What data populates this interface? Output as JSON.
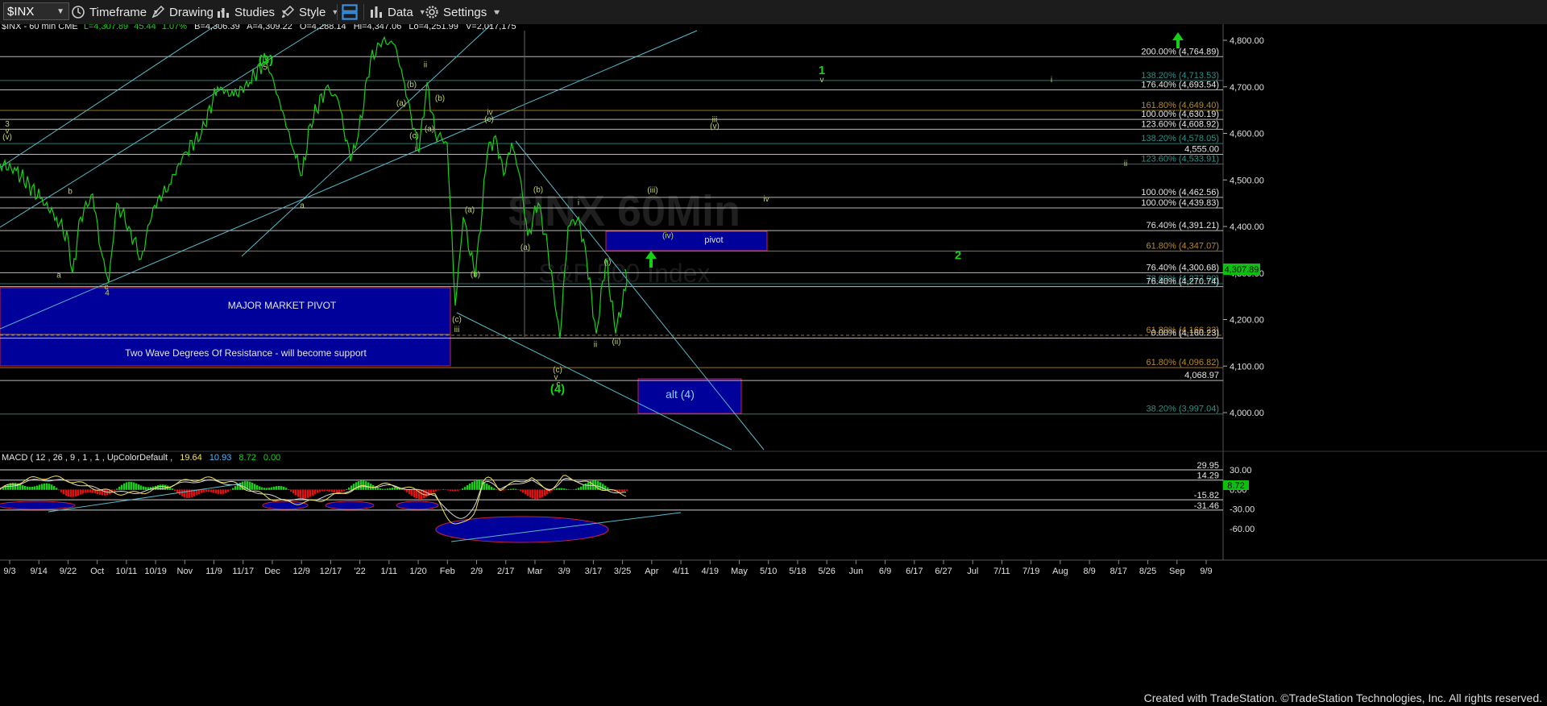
{
  "toolbar": {
    "symbol": "$INX",
    "timeframe": "Timeframe",
    "drawing": "Drawing",
    "studies": "Studies",
    "style": "Style",
    "data": "Data",
    "settings": "Settings"
  },
  "chart_data": {
    "type": "line",
    "header": {
      "symbol_line": "$INX - 60 min CME",
      "last": "L=4,307.89",
      "change": "45.44",
      "pct": "1.07%",
      "bid": "B=4,306.39",
      "ask": "A=4,309.22",
      "open": "O=4,288.14",
      "high": "Hi=4,347.06",
      "low": "Lo=4,251.99",
      "volume": "V=2,017,175"
    },
    "ylim": [
      3940,
      4830
    ],
    "y_ticks": [
      "4,800.00",
      "4,700.00",
      "4,600.00",
      "4,500.00",
      "4,400.00",
      "4,300.00",
      "4,200.00",
      "4,100.00",
      "4,000.00"
    ],
    "last_price_tag": "4,307.89",
    "x_labels": [
      "9/3",
      "9/14",
      "9/22",
      "Oct",
      "10/11",
      "10/19",
      "Nov",
      "11/9",
      "11/17",
      "Dec",
      "12/9",
      "12/17",
      "'22",
      "1/11",
      "1/20",
      "Feb",
      "2/9",
      "2/17",
      "Mar",
      "3/9",
      "3/17",
      "3/25",
      "Apr",
      "4/11",
      "4/19",
      "May",
      "5/10",
      "5/18",
      "5/26",
      "Jun",
      "6/9",
      "6/17",
      "6/27",
      "Jul",
      "7/11",
      "7/19",
      "Aug",
      "8/9",
      "8/17",
      "8/25",
      "Sep",
      "9/9"
    ],
    "price_series": {
      "name": "$INX",
      "points": [
        [
          0,
          4535
        ],
        [
          20,
          4520
        ],
        [
          50,
          4460
        ],
        [
          70,
          4420
        ],
        [
          85,
          4370
        ],
        [
          90,
          4300
        ],
        [
          100,
          4420
        ],
        [
          115,
          4470
        ],
        [
          125,
          4350
        ],
        [
          135,
          4280
        ],
        [
          145,
          4450
        ],
        [
          160,
          4400
        ],
        [
          175,
          4330
        ],
        [
          190,
          4440
        ],
        [
          210,
          4490
        ],
        [
          230,
          4560
        ],
        [
          250,
          4600
        ],
        [
          270,
          4700
        ],
        [
          290,
          4680
        ],
        [
          310,
          4710
        ],
        [
          330,
          4760
        ],
        [
          345,
          4680
        ],
        [
          365,
          4560
        ],
        [
          375,
          4510
        ],
        [
          385,
          4620
        ],
        [
          405,
          4700
        ],
        [
          420,
          4670
        ],
        [
          435,
          4540
        ],
        [
          445,
          4600
        ],
        [
          460,
          4760
        ],
        [
          475,
          4800
        ],
        [
          490,
          4790
        ],
        [
          500,
          4720
        ],
        [
          510,
          4640
        ],
        [
          520,
          4560
        ],
        [
          530,
          4710
        ],
        [
          540,
          4600
        ],
        [
          555,
          4580
        ],
        [
          565,
          4230
        ],
        [
          575,
          4420
        ],
        [
          590,
          4290
        ],
        [
          605,
          4560
        ],
        [
          615,
          4595
        ],
        [
          625,
          4510
        ],
        [
          635,
          4580
        ],
        [
          645,
          4510
        ],
        [
          655,
          4380
        ],
        [
          668,
          4450
        ],
        [
          680,
          4350
        ],
        [
          695,
          4160
        ],
        [
          705,
          4400
        ],
        [
          718,
          4420
        ],
        [
          728,
          4330
        ],
        [
          740,
          4170
        ],
        [
          752,
          4330
        ],
        [
          764,
          4170
        ],
        [
          778,
          4280
        ],
        [
          775,
          4307
        ]
      ]
    },
    "wave_labels": [
      {
        "text": "(3)",
        "x": 330,
        "y": 4750,
        "size": "large"
      },
      {
        "text": "5",
        "x": 329,
        "y": 4737
      },
      {
        "text": "3",
        "x": 9,
        "y": 4615
      },
      {
        "text": "v",
        "x": 9,
        "y": 4600
      },
      {
        "text": "(v)",
        "x": 9,
        "y": 4587
      },
      {
        "text": "b",
        "x": 87,
        "y": 4470
      },
      {
        "text": "a",
        "x": 73,
        "y": 4290
      },
      {
        "text": "c",
        "x": 132,
        "y": 4265
      },
      {
        "text": "4",
        "x": 133,
        "y": 4252
      },
      {
        "text": "a",
        "x": 375,
        "y": 4440
      },
      {
        "text": "ii",
        "x": 528,
        "y": 4742
      },
      {
        "text": "(b)",
        "x": 511,
        "y": 4700
      },
      {
        "text": "(a)",
        "x": 498,
        "y": 4660
      },
      {
        "text": "(b)",
        "x": 546,
        "y": 4670
      },
      {
        "text": "(c)",
        "x": 514,
        "y": 4590
      },
      {
        "text": "(a)",
        "x": 533,
        "y": 4604
      },
      {
        "text": "i",
        "x": 516,
        "y": 4563
      },
      {
        "text": "iv",
        "x": 608,
        "y": 4640
      },
      {
        "text": "(c)",
        "x": 607,
        "y": 4625
      },
      {
        "text": "(a)",
        "x": 583,
        "y": 4430
      },
      {
        "text": "(b)",
        "x": 590,
        "y": 4292
      },
      {
        "text": "(c)",
        "x": 567,
        "y": 4195
      },
      {
        "text": "iii",
        "x": 567,
        "y": 4173
      },
      {
        "text": "(b)",
        "x": 668,
        "y": 4474
      },
      {
        "text": "(a)",
        "x": 652,
        "y": 4350
      },
      {
        "text": "(c)",
        "x": 692,
        "y": 4087
      },
      {
        "text": "v",
        "x": 690,
        "y": 4071
      },
      {
        "text": "c",
        "x": 693,
        "y": 4056
      },
      {
        "text": "(4)",
        "x": 692,
        "y": 4042,
        "size": "large"
      },
      {
        "text": "i",
        "x": 718,
        "y": 4446
      },
      {
        "text": "(i)",
        "x": 754,
        "y": 4319
      },
      {
        "text": "ii",
        "x": 739,
        "y": 4141
      },
      {
        "text": "(ii)",
        "x": 765,
        "y": 4147
      },
      {
        "text": "(iii)",
        "x": 810,
        "y": 4473
      },
      {
        "text": "(iv)",
        "x": 829,
        "y": 4375
      },
      {
        "text": "iii",
        "x": 887,
        "y": 4624
      },
      {
        "text": "(v)",
        "x": 887,
        "y": 4610
      },
      {
        "text": "iv",
        "x": 951,
        "y": 4454
      },
      {
        "text": "1",
        "x": 1020,
        "y": 4727,
        "size": "large"
      },
      {
        "text": "v",
        "x": 1020,
        "y": 4710
      },
      {
        "text": "i",
        "x": 1305,
        "y": 4710
      },
      {
        "text": "ii",
        "x": 1397,
        "y": 4530
      },
      {
        "text": "2",
        "x": 1189,
        "y": 4330,
        "size": "large"
      }
    ],
    "fib_levels": [
      {
        "label": "200.00% (4,764.89)",
        "value": 4764.89,
        "color": "#d8d8d8",
        "dashed": false
      },
      {
        "label": "138.20% (4,713.53)",
        "value": 4713.53,
        "color": "#2f8f86",
        "dashed": false
      },
      {
        "label": "176.40% (4,693.54)",
        "value": 4693.54,
        "color": "#d8d8d8",
        "dashed": false
      },
      {
        "label": "161.80% (4,649.40)",
        "value": 4649.4,
        "color": "#b48a2a",
        "dashed": false
      },
      {
        "label": "100.00% (4,630.19)",
        "value": 4630.19,
        "color": "#d8d8d8",
        "dashed": false
      },
      {
        "label": "123.60% (4,608.92)",
        "value": 4608.92,
        "color": "#d8d8d8",
        "dashed": false
      },
      {
        "label": "138.20% (4,578.05)",
        "value": 4578.05,
        "color": "#2f8f86",
        "dashed": false
      },
      {
        "label": "4,555.00",
        "value": 4555.0,
        "color": "#d8d8d8",
        "dashed": false
      },
      {
        "label": "123.60% (4,533.91)",
        "value": 4533.91,
        "color": "#2f8f86",
        "dashed": false
      },
      {
        "label": "100.00% (4,462.56)",
        "value": 4462.56,
        "color": "#d8d8d8",
        "dashed": false
      },
      {
        "label": "100.00% (4,439.83)",
        "value": 4439.83,
        "color": "#d8d8d8",
        "dashed": false
      },
      {
        "label": "76.40% (4,391.21)",
        "value": 4391.21,
        "color": "#d8d8d8",
        "dashed": false
      },
      {
        "label": "61.80% (4,347.07)",
        "value": 4347.07,
        "color": "#b48a2a",
        "dashed": false
      },
      {
        "label": "76.40% (4,300.68)",
        "value": 4300.68,
        "color": "#d8d8d8",
        "dashed": false
      },
      {
        "label": "78.60% (4,277.00)",
        "value": 4277.0,
        "color": "#2f8f86",
        "dashed": false
      },
      {
        "label": "76.40% (4,270.74)",
        "value": 4270.74,
        "color": "#d8d8d8",
        "dashed": false
      },
      {
        "label": "61.80% (4,166.23)",
        "value": 4166.23,
        "color": "#b48a2a",
        "dashed": true
      },
      {
        "label": "0.00% (4,160.23)",
        "value": 4160.23,
        "color": "#d8d8d8",
        "dashed": false
      },
      {
        "label": "61.80% (4,096.82)",
        "value": 4096.82,
        "color": "#b48a2a",
        "dashed": false
      },
      {
        "label": "4,068.97",
        "value": 4068.97,
        "color": "#d8d8d8",
        "dashed": false
      },
      {
        "label": "38.20% (3,997.04)",
        "value": 3997.04,
        "color": "#2f8f86",
        "dashed": false
      }
    ],
    "boxes": [
      {
        "label": "MAJOR MARKET PIVOT",
        "sub": "Two Wave Degrees Of Resistance - will become support",
        "y_top": 4265,
        "y_bottom": 4100,
        "x_start": 0,
        "x_end": 559
      },
      {
        "label": "pivot",
        "y_top": 4395,
        "y_bottom": 4340,
        "x_start": 752,
        "x_end": 952
      },
      {
        "label": "alt (4)",
        "y_top": 4065,
        "y_bottom": 4000,
        "x_start": 792,
        "x_end": 920
      }
    ],
    "macd": {
      "title": "MACD ( 12 , 26 , 9 , 1 , 1 , UpColorDefault ,",
      "value1": "19.64",
      "value2": "10.93",
      "value3": "8.72",
      "value4": "0.00",
      "ylim": [
        -75,
        40
      ],
      "y_ticks": [
        "30.00",
        "0.00",
        "-30.00",
        "-60.00"
      ],
      "levels": [
        {
          "label": "29.95",
          "value": 29.95
        },
        {
          "label": "14.29",
          "value": 14.29
        },
        {
          "label": "-15.82",
          "value": -15.82
        },
        {
          "label": "-31.46",
          "value": -31.46
        }
      ],
      "last_tag": "8.72"
    }
  },
  "footer": "Created with TradeStation. ©TradeStation Technologies, Inc. All rights reserved."
}
